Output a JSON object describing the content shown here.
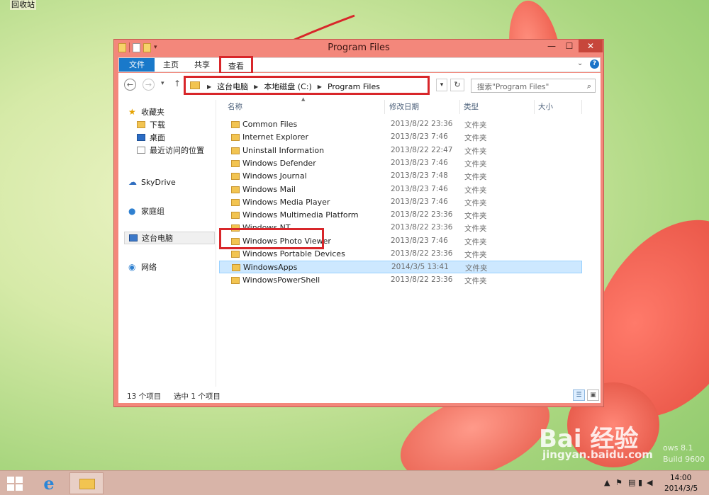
{
  "desktop": {
    "recycle_bin_label": "回收站",
    "watermark": "Bai 经验",
    "watermark_url": "jingyan.baidu.com",
    "build_line1": "ows 8.1",
    "build_line2": "Build 9600"
  },
  "window": {
    "title": "Program Files",
    "minimize": "—",
    "maximize": "☐",
    "close": "✕"
  },
  "ribbon": {
    "tabs": [
      {
        "label": "文件"
      },
      {
        "label": "主页"
      },
      {
        "label": "共享"
      },
      {
        "label": "查看"
      }
    ],
    "expand": "⌄",
    "help": "?"
  },
  "address": {
    "back": "←",
    "forward": "→",
    "recent": "▾",
    "up": "↑",
    "crumbs": [
      "这台电脑",
      "本地磁盘 (C:)",
      "Program Files"
    ],
    "separator": "▶",
    "dropdown": "▾",
    "refresh": "↻",
    "search_placeholder": "搜索\"Program Files\"",
    "search_icon": "⌕"
  },
  "nav_pane": {
    "favorites": "收藏夹",
    "downloads": "下载",
    "desktop": "桌面",
    "recent": "最近访问的位置",
    "skydrive": "SkyDrive",
    "homegroup": "家庭组",
    "this_pc": "这台电脑",
    "network": "网络"
  },
  "columns": {
    "name": "名称",
    "date": "修改日期",
    "type": "类型",
    "size": "大小"
  },
  "files": [
    {
      "name": "Common Files",
      "date": "2013/8/22 23:36",
      "type": "文件夹"
    },
    {
      "name": "Internet Explorer",
      "date": "2013/8/23 7:46",
      "type": "文件夹"
    },
    {
      "name": "Uninstall Information",
      "date": "2013/8/22 22:47",
      "type": "文件夹"
    },
    {
      "name": "Windows Defender",
      "date": "2013/8/23 7:46",
      "type": "文件夹"
    },
    {
      "name": "Windows Journal",
      "date": "2013/8/23 7:48",
      "type": "文件夹"
    },
    {
      "name": "Windows Mail",
      "date": "2013/8/23 7:46",
      "type": "文件夹"
    },
    {
      "name": "Windows Media Player",
      "date": "2013/8/23 7:46",
      "type": "文件夹"
    },
    {
      "name": "Windows Multimedia Platform",
      "date": "2013/8/22 23:36",
      "type": "文件夹"
    },
    {
      "name": "Windows NT",
      "date": "2013/8/22 23:36",
      "type": "文件夹"
    },
    {
      "name": "Windows Photo Viewer",
      "date": "2013/8/23 7:46",
      "type": "文件夹"
    },
    {
      "name": "Windows Portable Devices",
      "date": "2013/8/22 23:36",
      "type": "文件夹"
    },
    {
      "name": "WindowsApps",
      "date": "2014/3/5 13:41",
      "type": "文件夹"
    },
    {
      "name": "WindowsPowerShell",
      "date": "2013/8/22 23:36",
      "type": "文件夹"
    }
  ],
  "status": {
    "count": "13 个项目",
    "selected": "选中 1 个项目"
  },
  "taskbar": {
    "clock_time": "14:00",
    "clock_date": "2014/3/5"
  },
  "colors": {
    "window_frame": "#f3877b",
    "annotation_red": "#d8262a",
    "selection": "#cde8ff"
  }
}
